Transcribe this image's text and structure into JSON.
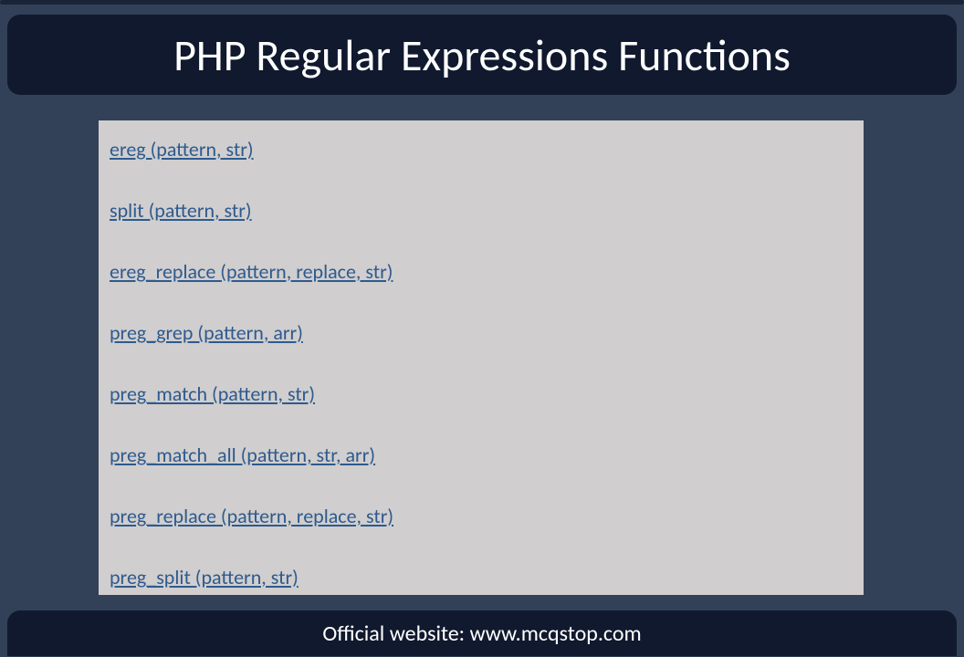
{
  "title": "PHP Regular Expressions Functions",
  "functions": [
    "ereg (pattern, str)",
    " split (pattern, str)",
    " ereg_replace (pattern, replace, str)",
    " preg_grep (pattern, arr)",
    " preg_match (pattern, str)",
    " preg_match_all (pattern, str, arr)",
    " preg_replace (pattern, replace, str)",
    " preg_split (pattern, str)"
  ],
  "footer": "Official website: www.mcqstop.com"
}
